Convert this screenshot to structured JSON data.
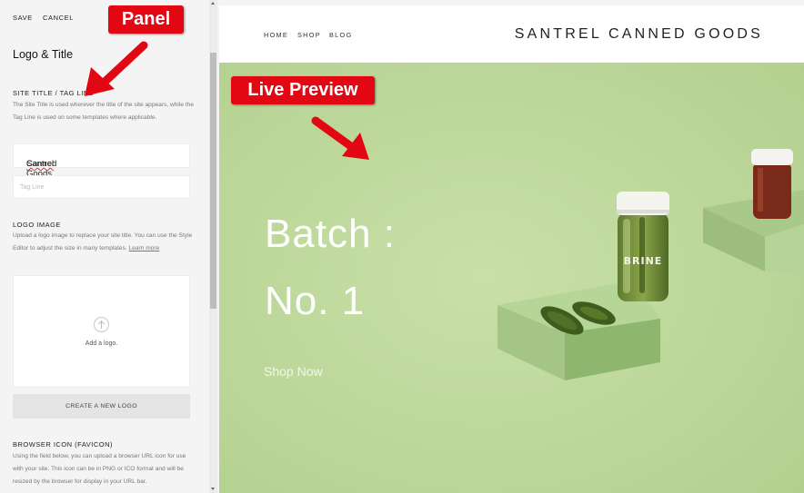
{
  "panel": {
    "save_label": "SAVE",
    "cancel_label": "CANCEL",
    "heading": "Logo & Title",
    "site_title_section": {
      "title": "SITE TITLE / TAG LINE",
      "description": "The Site Title is used wherever the title of the site appears, while the Tag Line is used on some templates where applicable.",
      "site_title_value": "Santrel Canned Goods",
      "tagline_placeholder": "Tag Line"
    },
    "logo_section": {
      "title": "LOGO IMAGE",
      "description": "Upload a logo image to replace your site title. You can use the Style Editor to adjust the size in many templates.",
      "learn_more": "Learn more",
      "add_logo_label": "Add a logo.",
      "create_logo_button": "CREATE A NEW LOGO"
    },
    "favicon_section": {
      "title": "BROWSER ICON (FAVICON)",
      "description": "Using the field below, you can upload a browser URL icon for use with your site. This icon can be in PNG or ICO format and will be resized by the browser for display in your URL bar."
    }
  },
  "preview": {
    "nav": [
      "HOME",
      "SHOP",
      "BLOG"
    ],
    "site_name": "SANTREL CANNED GOODS",
    "hero_line1": "Batch :",
    "hero_line2": "No. 1",
    "cta": "Shop Now",
    "jar_label": "BRINE",
    "hero_color": "#c3dba1"
  },
  "annotations": {
    "panel_label": "Panel",
    "live_preview_label": "Live Preview",
    "color": "#e30613"
  }
}
